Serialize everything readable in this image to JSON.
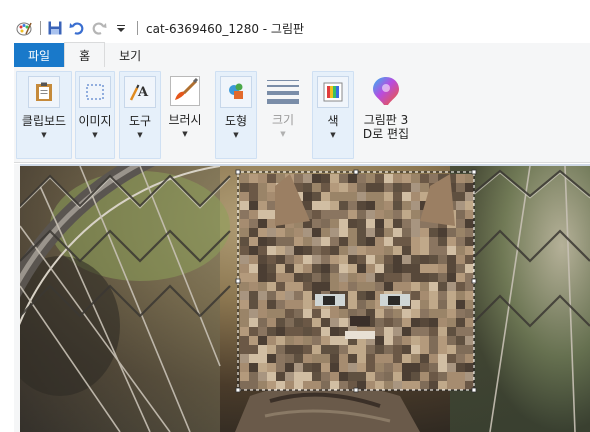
{
  "window": {
    "title": "cat-6369460_1280 - 그림판"
  },
  "tabs": [
    {
      "label": "파일"
    },
    {
      "label": "홈"
    },
    {
      "label": "보기"
    }
  ],
  "ribbon": {
    "clipboard": {
      "label": "클립보드"
    },
    "image": {
      "label": "이미지"
    },
    "tools": {
      "label": "도구"
    },
    "brushes": {
      "label": "브러시"
    },
    "shapes": {
      "label": "도형"
    },
    "size": {
      "label": "크기"
    },
    "colors": {
      "label": "색"
    },
    "paint3d": {
      "label_line1": "그림판 3",
      "label_line2": "D로 편집"
    }
  },
  "colors": {
    "accent": "#1979ca",
    "ribbon_bg": "#f5f6f7",
    "selected_group_bg": "#e6f0fa"
  }
}
